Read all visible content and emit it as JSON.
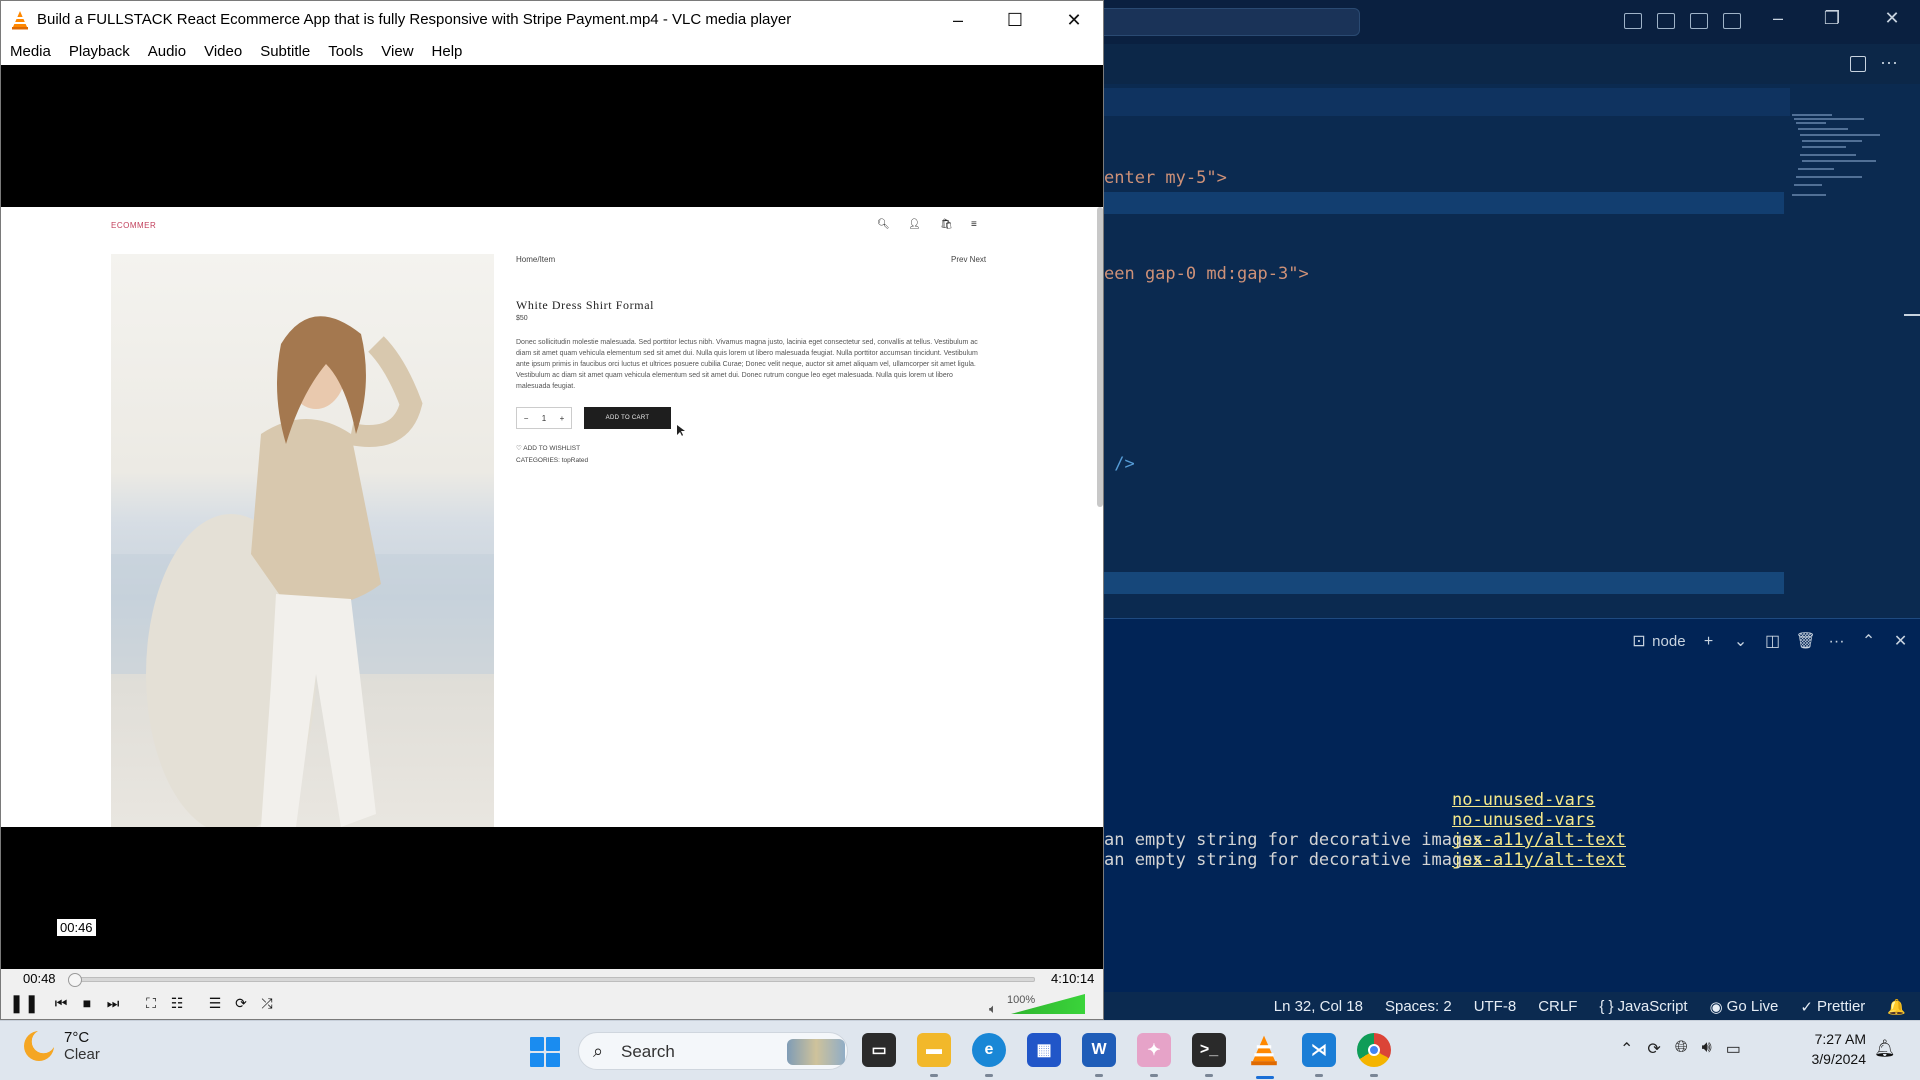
{
  "vscode": {
    "code_lines": [
      {
        "prefix": "enter my-5\">",
        "kind": "str"
      },
      {
        "prefix": "een gap-0 md:gap-3\">",
        "kind": "str"
      },
      {
        "prefix": " />",
        "kind": "tag"
      }
    ],
    "panel": {
      "terminal_label": "node",
      "problems": [
        {
          "message": "",
          "rule": "no-unused-vars"
        },
        {
          "message": "",
          "rule": "no-unused-vars"
        },
        {
          "message": "an empty string for decorative images",
          "rule": "jsx-a11y/alt-text"
        },
        {
          "message": "an empty string for decorative images",
          "rule": "jsx-a11y/alt-text"
        }
      ]
    },
    "statusbar": {
      "position": "Ln 32, Col 18",
      "spaces": "Spaces: 2",
      "encoding": "UTF-8",
      "eol": "CRLF",
      "language": "JavaScript",
      "golive": "Go Live",
      "prettier": "Prettier"
    }
  },
  "vlc": {
    "title": "Build a FULLSTACK React Ecommerce App that is fully Responsive with Stripe Payment.mp4 - VLC media player",
    "menu": [
      "Media",
      "Playback",
      "Audio",
      "Video",
      "Subtitle",
      "Tools",
      "View",
      "Help"
    ],
    "hover_time": "00:46",
    "elapsed": "00:48",
    "total": "4:10:14",
    "progress_fraction": 0.0032,
    "volume_label": "100%",
    "volume_fraction": 1.0,
    "web": {
      "logo": "ECOMMER",
      "breadcrumb": "Home/Item",
      "prev_next": "Prev Next",
      "product_title": "White Dress Shirt Formal",
      "price": "$50",
      "description": "Donec sollicitudin molestie malesuada. Sed porttitor lectus nibh. Vivamus magna justo, lacinia eget consectetur sed, convallis at tellus. Vestibulum ac diam sit amet quam vehicula elementum sed sit amet dui. Nulla quis lorem ut libero malesuada feugiat. Nulla porttitor accumsan tincidunt. Vestibulum ante ipsum primis in faucibus orci luctus et ultrices posuere cubilia Curae; Donec velit neque, auctor sit amet aliquam vel, ullamcorper sit amet ligula. Vestibulum ac diam sit amet quam vehicula elementum sed sit amet dui. Donec rutrum congue leo eget malesuada. Nulla quis lorem ut libero malesuada feugiat.",
      "qty_minus": "−",
      "qty_value": "1",
      "qty_plus": "+",
      "add_to_cart": "ADD TO CART",
      "wishlist": "ADD TO WISHLIST",
      "categories": "CATEGORIES: topRated"
    }
  },
  "taskbar": {
    "temperature": "7°C",
    "condition": "Clear",
    "search_placeholder": "Search",
    "time": "7:27 AM",
    "date": "3/9/2024"
  }
}
